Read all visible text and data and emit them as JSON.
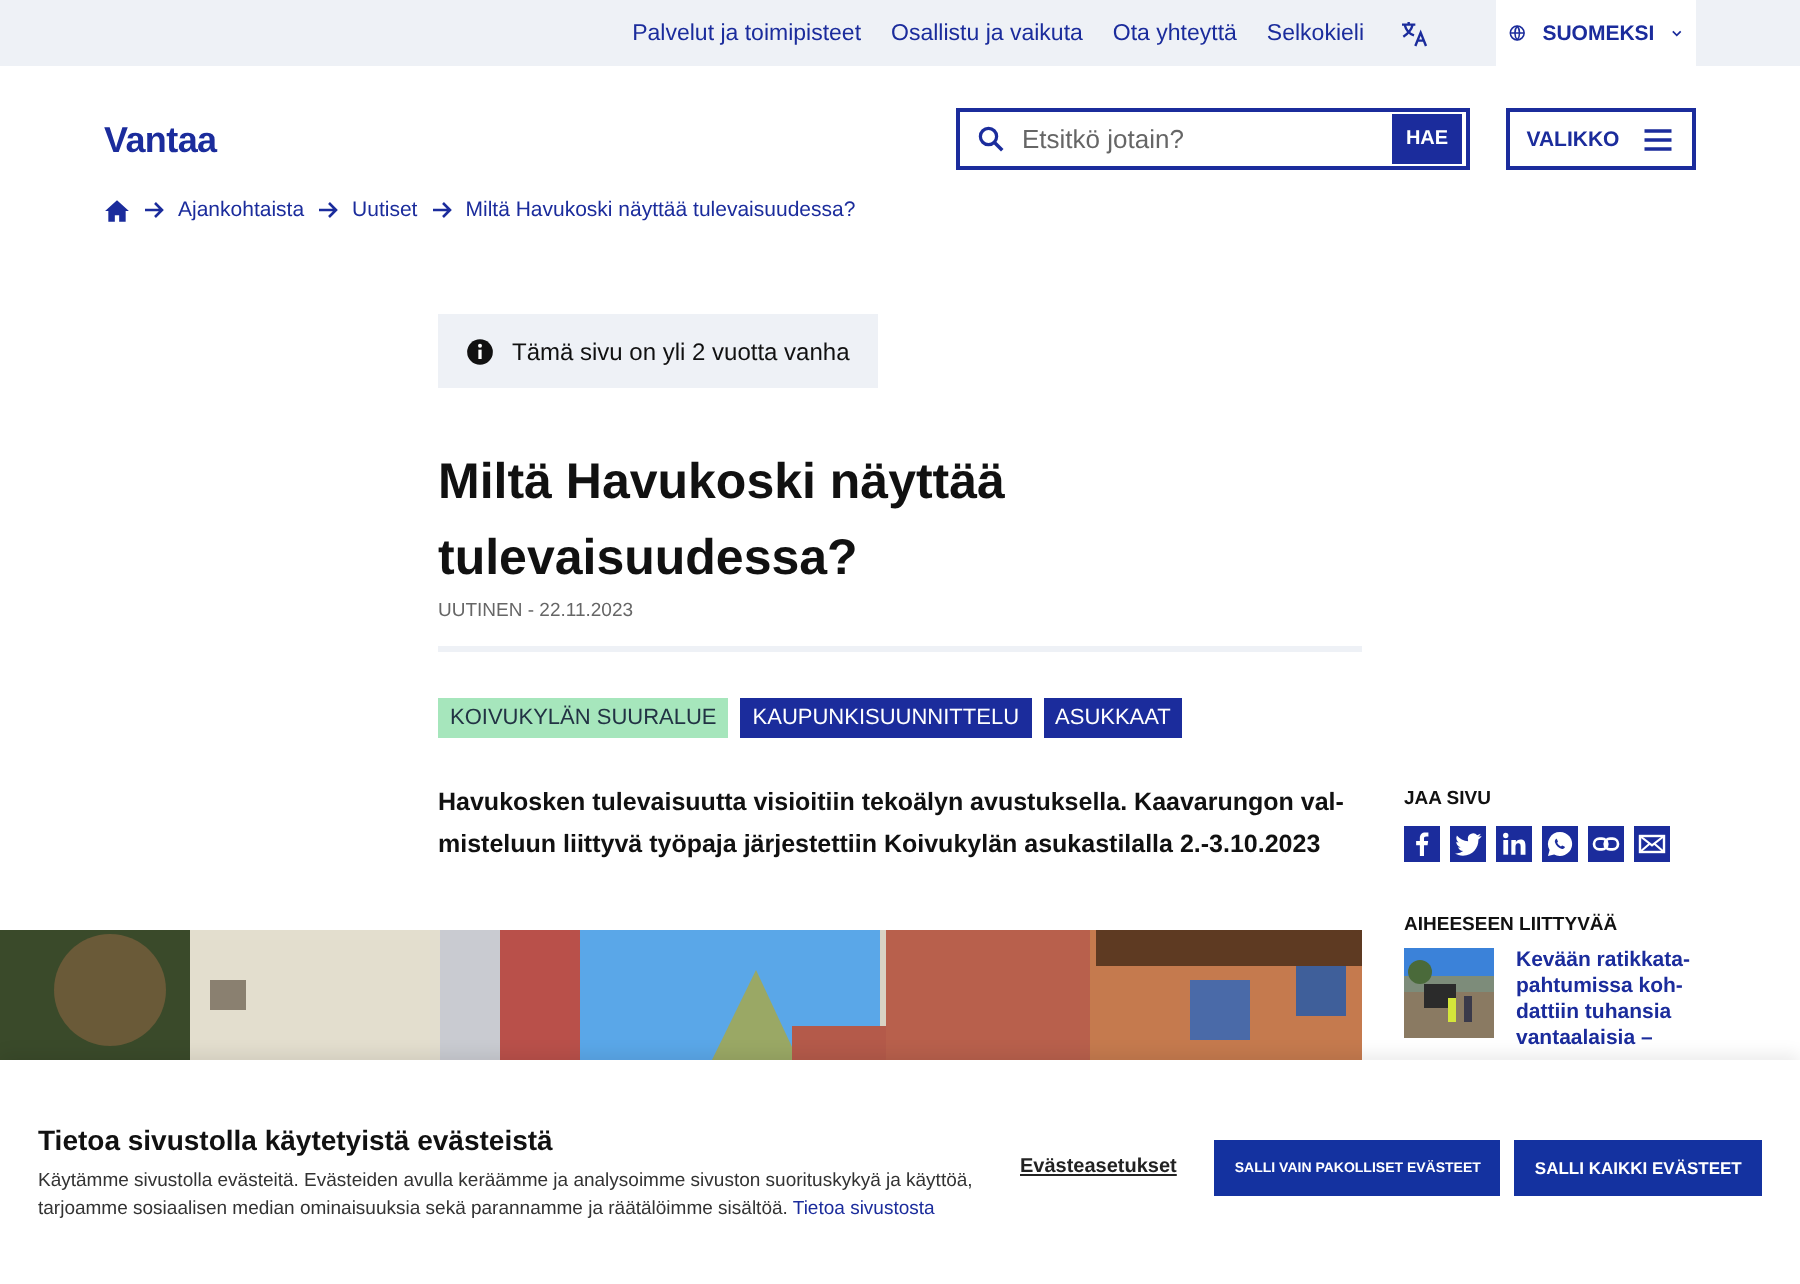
{
  "utility_nav": {
    "links": [
      "Palvelut ja toimipisteet",
      "Osallistu ja vaikuta",
      "Ota yhteyttä",
      "Selkokieli"
    ],
    "language": "SUOMEKSI"
  },
  "header": {
    "logo": "Vantaa",
    "search": {
      "placeholder": "Etsitkö jotain?",
      "button": "HAE"
    },
    "menu_button": "VALIKKO"
  },
  "breadcrumb": [
    "Ajankohtaista",
    "Uutiset",
    "Miltä Havukoski näyttää tulevaisuudessa?"
  ],
  "notice": "Tämä sivu on yli 2 vuotta vanha",
  "article": {
    "title": "Miltä Havukoski näyttää tulevaisuudessa?",
    "meta": "UUTINEN - 22.11.2023",
    "tags": [
      {
        "label": "KOIVUKYLÄN SUURALUE",
        "kind": "area"
      },
      {
        "label": "KAUPUNKISUUNNITTELU",
        "kind": "topic"
      },
      {
        "label": "ASUKKAAT",
        "kind": "topic"
      }
    ],
    "lead": "Havukosken tulevaisuutta visioitiin tekoälyn avustuksella. Kaavarungon val-misteluun liittyvä työpaja järjestettiin Koivukylän asukastilalla 2.-3.10.2023"
  },
  "sidebar": {
    "share_title": "JAA SIVU",
    "share": [
      {
        "kind": "facebook"
      },
      {
        "kind": "twitter"
      },
      {
        "kind": "linkedin"
      },
      {
        "kind": "whatsapp"
      },
      {
        "kind": "link"
      },
      {
        "kind": "email"
      }
    ],
    "related_title": "AIHEESEEN LIITTYVÄÄ",
    "related": [
      {
        "title": "Kevään ratikkata-pahtumissa koh-dattiin tuhansia vantaalaisia –"
      }
    ]
  },
  "cookie": {
    "title": "Tietoa sivustolla käytetyistä evästeistä",
    "text": "Käytämme sivustolla evästeitä. Evästeiden avulla keräämme ja analysoimme sivuston suorituskykyä ja käyttöä, tarjoamme sosiaalisen median ominaisuuksia sekä parannamme ja räätälöimme sisältöä.",
    "link": "Tietoa sivustosta",
    "settings": "Evästeasetukset",
    "buttons": [
      "SALLI VAIN PAKOLLISET EVÄSTEET",
      "SALLI KAIKKI EVÄSTEET"
    ]
  }
}
